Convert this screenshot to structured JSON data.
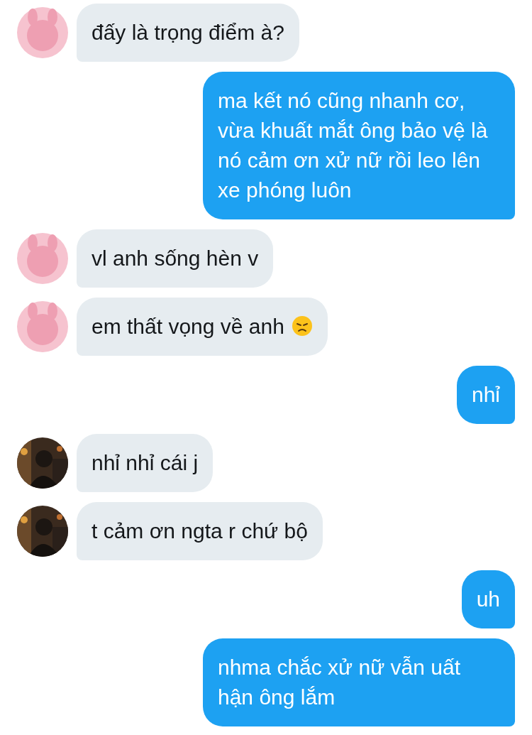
{
  "messages": [
    {
      "kind": "incoming",
      "avatar": {
        "kind": "cartoon"
      },
      "text": "đấy là trọng điểm à?"
    },
    {
      "kind": "outgoing",
      "text": "ma kết nó cũng nhanh cơ, vừa khuất mắt ông bảo vệ là nó cảm ơn xử nữ rồi leo lên xe phóng luôn"
    },
    {
      "kind": "incoming",
      "avatar": {
        "kind": "cartoon"
      },
      "text": "vl anh sống hèn v"
    },
    {
      "kind": "incoming",
      "avatar": {
        "kind": "cartoon"
      },
      "text": "em thất vọng về anh",
      "emoji": {
        "kind": "sad"
      }
    },
    {
      "kind": "outgoing",
      "text": "nhỉ"
    },
    {
      "kind": "incoming",
      "text": "nhỉ nhỉ cái j"
    },
    {
      "kind": "incoming",
      "text": "t cảm ơn ngta r chứ bộ"
    },
    {
      "kind": "outgoing",
      "text": "uh"
    },
    {
      "kind": "outgoing",
      "text": "nhma chắc xử nữ vẫn uất hận ông lắm"
    }
  ]
}
